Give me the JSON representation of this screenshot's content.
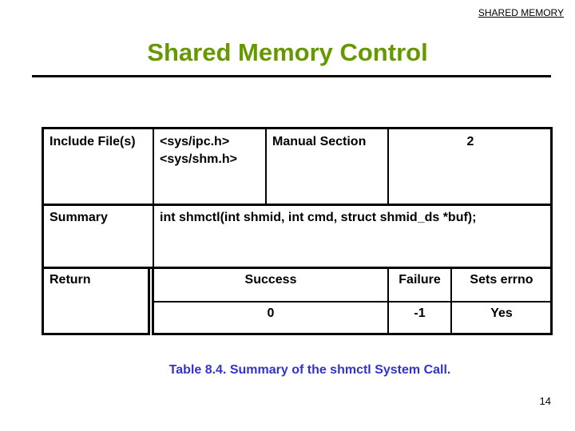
{
  "header": {
    "section_label": "SHARED MEMORY"
  },
  "slide": {
    "title": "Shared Memory Control",
    "title_color": "#669900"
  },
  "table": {
    "include_files": {
      "label": "Include File(s)",
      "values": [
        "<sys/ipc.h>",
        "<sys/shm.h>"
      ]
    },
    "manual_section": {
      "label": "Manual Section",
      "value": "2"
    },
    "summary": {
      "label": "Summary",
      "value": "int shmctl(int shmid, int cmd, struct shmid_ds *buf);"
    },
    "return": {
      "label": "Return",
      "headers": [
        "Success",
        "Failure",
        "Sets errno"
      ],
      "values": [
        "0",
        "-1",
        "Yes"
      ]
    }
  },
  "caption": {
    "text": "Table 8.4. Summary of the shmctl System Call.",
    "color": "#3333cc"
  },
  "footer": {
    "page_number": "14"
  }
}
